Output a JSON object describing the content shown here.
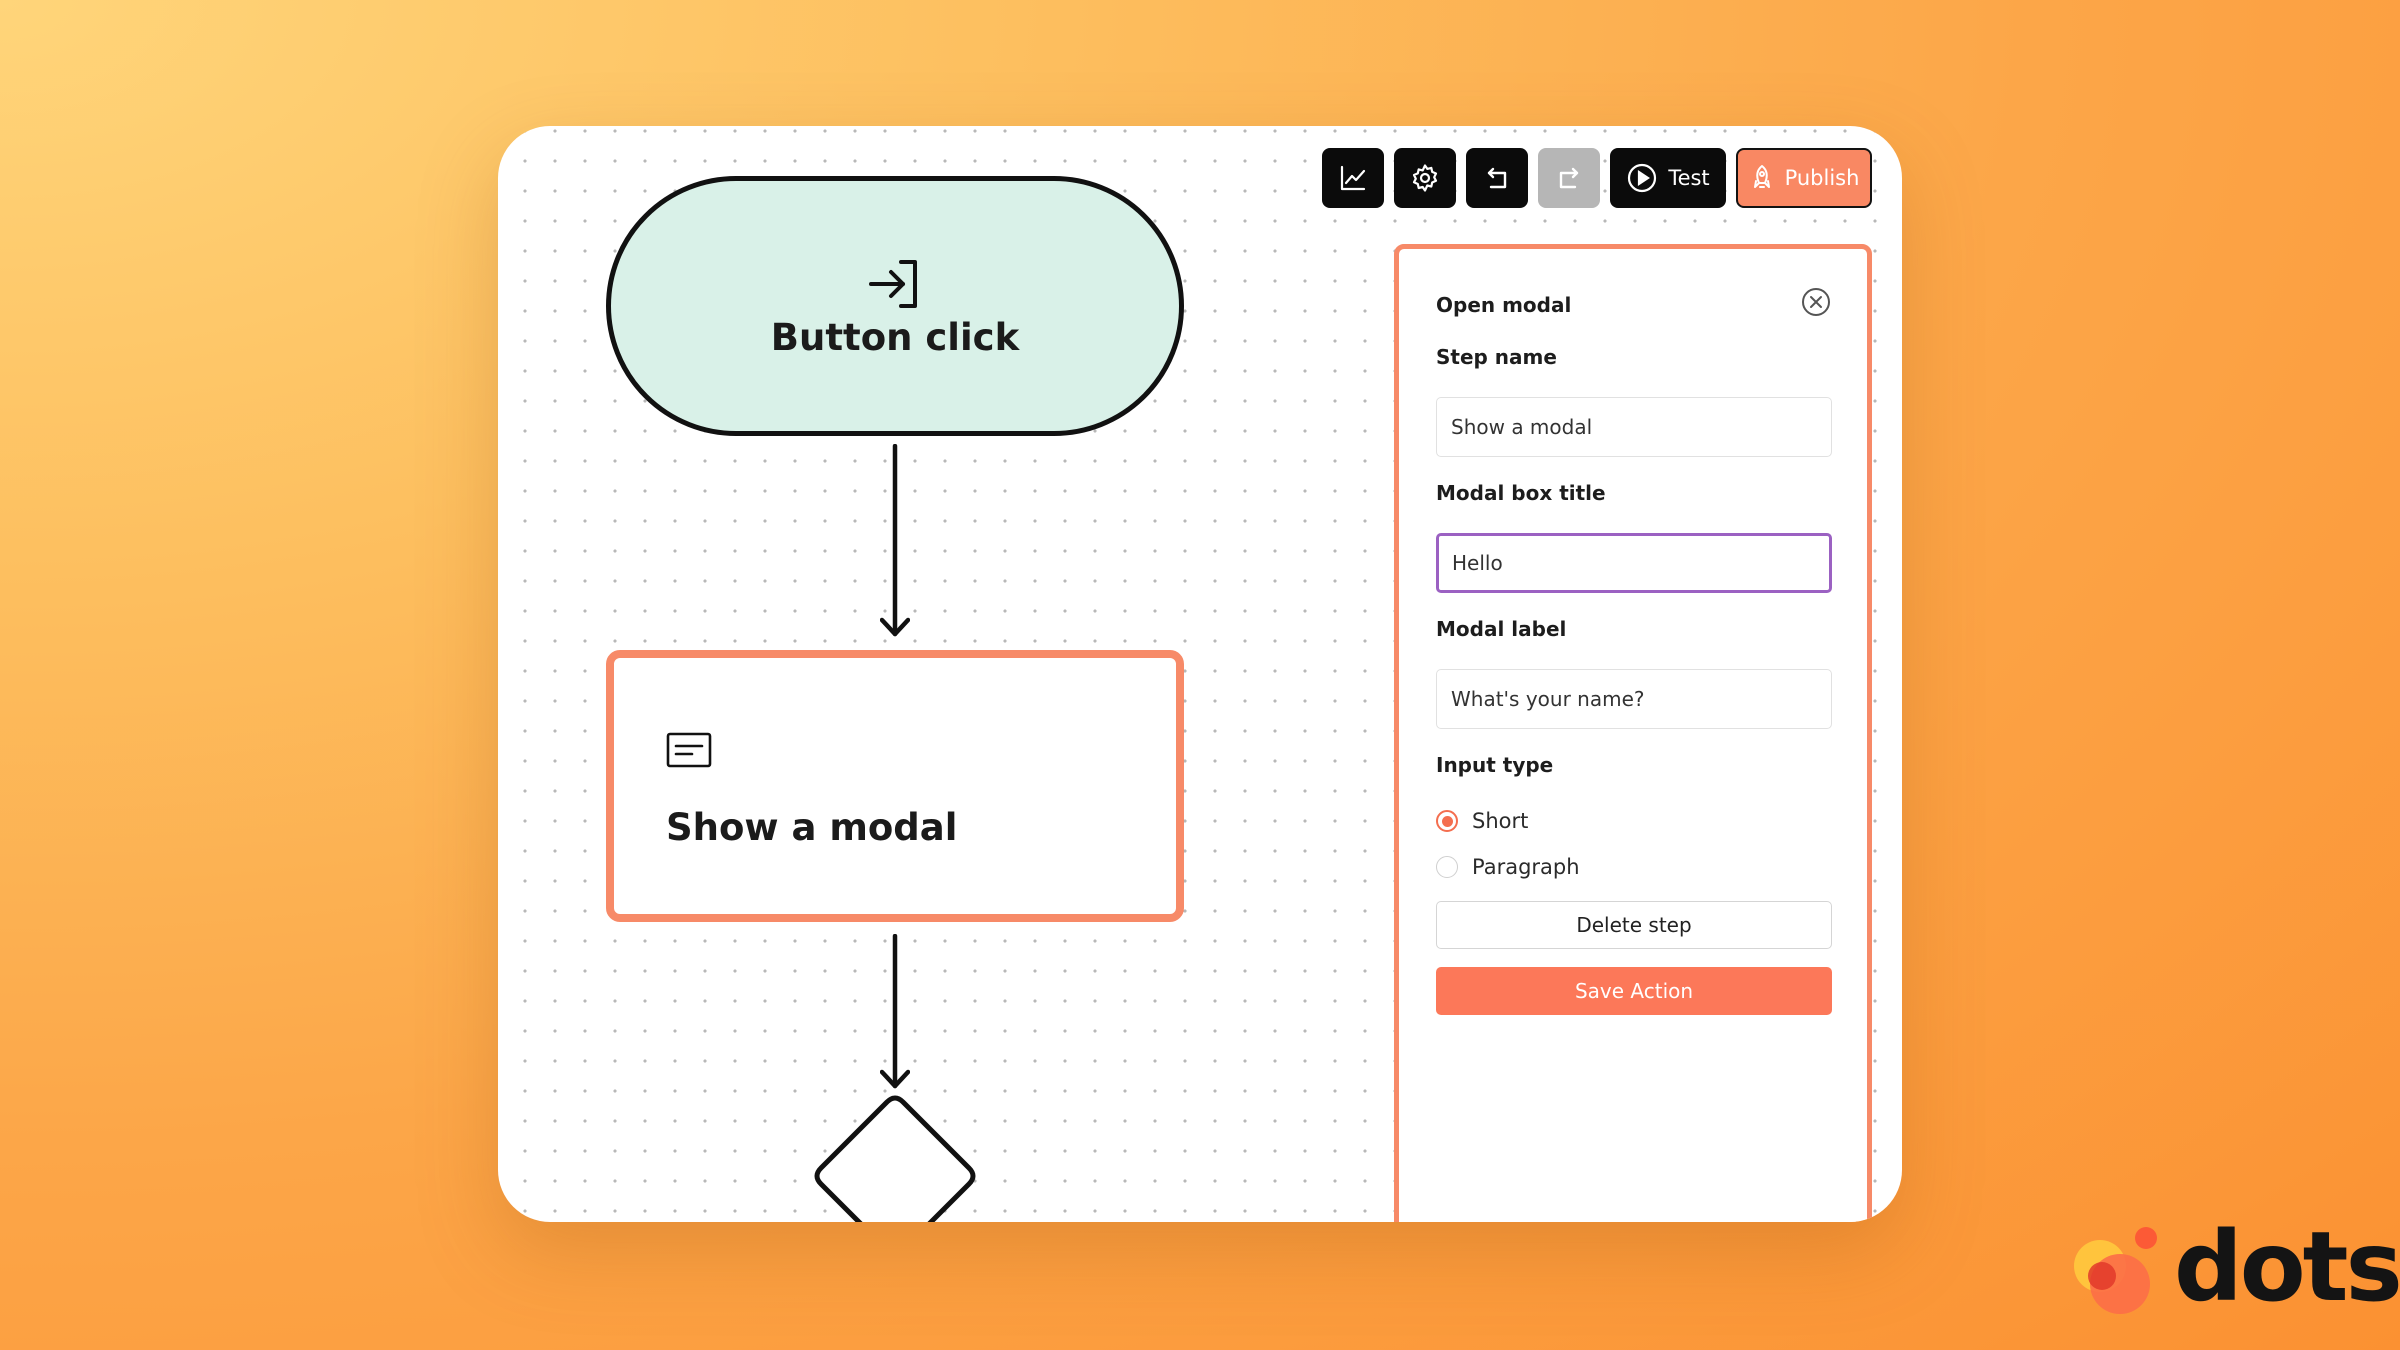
{
  "canvas": {
    "trigger_node": {
      "label": "Button click",
      "icon": "login-arrow-icon"
    },
    "action_node": {
      "label": "Show a modal",
      "icon": "modal-window-icon"
    },
    "condition_node": {
      "icon": "diamond-shape"
    }
  },
  "toolbar": {
    "analytics_icon": "line-chart-icon",
    "settings_icon": "gear-icon",
    "undo_icon": "undo-icon",
    "redo_icon": "redo-icon",
    "test_label": "Test",
    "publish_label": "Publish"
  },
  "panel": {
    "heading": "Open modal",
    "close_icon": "close-circle-icon",
    "step_name": {
      "label": "Step name",
      "value": "Show a modal"
    },
    "modal_title": {
      "label": "Modal box title",
      "value": "Hello"
    },
    "modal_label": {
      "label": "Modal label",
      "value": "What's your name?"
    },
    "input_type": {
      "label": "Input type",
      "options": [
        {
          "label": "Short",
          "selected": true
        },
        {
          "label": "Paragraph",
          "selected": false
        }
      ]
    },
    "delete_label": "Delete step",
    "save_label": "Save Action"
  },
  "brand": {
    "name": "dots"
  },
  "colors": {
    "accent": "#f98863",
    "primary_button": "#fc7859",
    "trigger_fill": "#d9f1e8",
    "focus_border": "#9b61c2"
  }
}
